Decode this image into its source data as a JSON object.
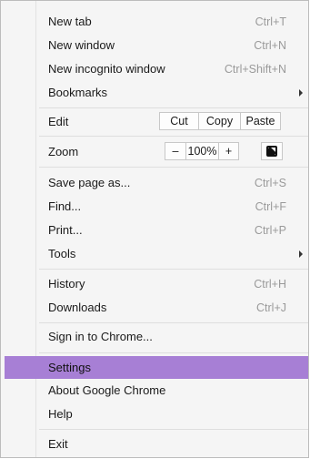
{
  "menu": {
    "new_tab": {
      "label": "New tab",
      "shortcut": "Ctrl+T"
    },
    "new_window": {
      "label": "New window",
      "shortcut": "Ctrl+N"
    },
    "new_incognito": {
      "label": "New incognito window",
      "shortcut": "Ctrl+Shift+N"
    },
    "bookmarks": {
      "label": "Bookmarks"
    },
    "edit": {
      "label": "Edit",
      "cut": "Cut",
      "copy": "Copy",
      "paste": "Paste"
    },
    "zoom": {
      "label": "Zoom",
      "minus": "–",
      "value": "100%",
      "plus": "+"
    },
    "save_page": {
      "label": "Save page as...",
      "shortcut": "Ctrl+S"
    },
    "find": {
      "label": "Find...",
      "shortcut": "Ctrl+F"
    },
    "print": {
      "label": "Print...",
      "shortcut": "Ctrl+P"
    },
    "tools": {
      "label": "Tools"
    },
    "history": {
      "label": "History",
      "shortcut": "Ctrl+H"
    },
    "downloads": {
      "label": "Downloads",
      "shortcut": "Ctrl+J"
    },
    "sign_in": {
      "label": "Sign in to Chrome..."
    },
    "settings": {
      "label": "Settings"
    },
    "about": {
      "label": "About Google Chrome"
    },
    "help": {
      "label": "Help"
    },
    "exit": {
      "label": "Exit"
    }
  },
  "colors": {
    "highlight": "#a77fd5",
    "shortcut": "#9a9a9a"
  },
  "icons": {
    "fullscreen": "fullscreen-icon",
    "submenu": "chevron-right-icon"
  }
}
